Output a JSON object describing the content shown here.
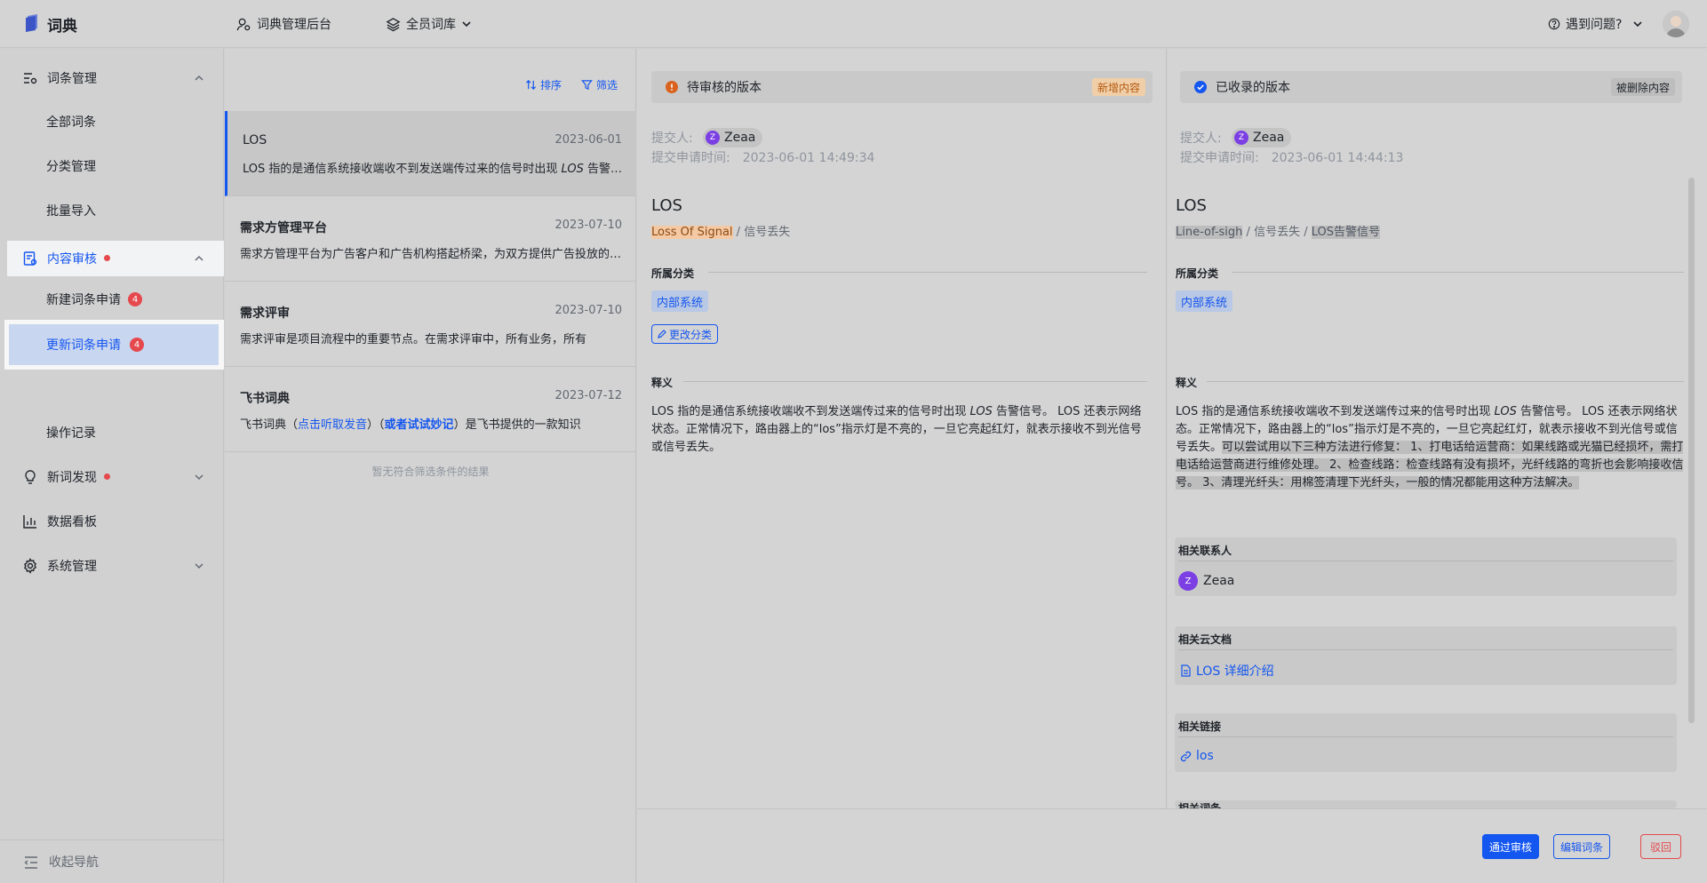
{
  "header": {
    "app_name": "词典",
    "admin_label": "词典管理后台",
    "library_label": "全员词库",
    "help_label": "遇到问题?"
  },
  "sidebar": {
    "groups": [
      {
        "label": "词条管理"
      },
      {
        "label": "内容审核"
      },
      {
        "label": "新词发现"
      },
      {
        "label": "数据看板"
      },
      {
        "label": "系统管理"
      }
    ],
    "subs": [
      {
        "label": "全部词条"
      },
      {
        "label": "分类管理"
      },
      {
        "label": "批量导入"
      },
      {
        "label": "新建词条申请",
        "badge": "4"
      },
      {
        "label": "更新词条申请",
        "badge": "4"
      },
      {
        "label": "操作记录"
      }
    ],
    "collapse_label": "收起导航"
  },
  "list": {
    "sort_label": "排序",
    "filter_label": "筛选",
    "items": [
      {
        "title": "LOS",
        "date": "2023-06-01",
        "desc_a": "LOS 指的是通信系统接收端收不到发送端传过来的信号时出现 ",
        "desc_b": "LOS",
        "desc_c": " 告警信号"
      },
      {
        "title": "需求方管理平台",
        "date": "2023-07-10",
        "desc": "需求方管理平台为广告客户和广告机构搭起桥梁，为双方提供广告投放的一站式服务"
      },
      {
        "title": "需求评审",
        "date": "2023-07-10",
        "desc": "需求评审是项目流程中的重要节点。在需求评审中，所有业务，所有"
      },
      {
        "title": "飞书词典",
        "date": "2023-07-12",
        "desc_a": "飞书词典（",
        "link_a": "点击听取发音",
        "desc_b": "）（",
        "link_b": "或者试试妙记",
        "desc_c": "）是飞书提供的一款知识"
      }
    ],
    "empty": "暂无符合筛选条件的结果"
  },
  "pending": {
    "title": "待审核的版本",
    "tag": "新增内容",
    "submitter_label": "提交人:",
    "submitter": "Zeaa",
    "submitter_initial": "Z",
    "time_label": "提交申请时间:",
    "time": "2023-06-01 14:49:34",
    "word": "LOS",
    "alias_a": "Loss Of Signal",
    "alias_sep": " / ",
    "alias_b": "信号丢失",
    "category_heading": "所属分类",
    "category": "内部系统",
    "edit_category": "更改分类",
    "definition_heading": "释义",
    "def_a": "LOS 指的是通信系统接收端收不到发送端传过来的信号时出现 ",
    "def_b": "LOS",
    "def_c": " 告警信号。 LOS 还表示网络状态。正常情况下，路由器上的“los”指示灯是不亮的，一旦它亮起红灯，就表示接收不到光信号或信号丢失。"
  },
  "accepted": {
    "title": "已收录的版本",
    "tag": "被删除内容",
    "submitter_label": "提交人:",
    "submitter": "Zeaa",
    "submitter_initial": "Z",
    "time_label": "提交申请时间:",
    "time": "2023-06-01 14:44:13",
    "word": "LOS",
    "alias_a": "Line-of-sigh",
    "alias_sep": " / ",
    "alias_b": "信号丢失",
    "alias_sep2": " / ",
    "alias_c": "LOS告警信号",
    "category_heading": "所属分类",
    "category": "内部系统",
    "definition_heading": "释义",
    "def_a": "LOS 指的是通信系统接收端收不到发送端传过来的信号时出现 ",
    "def_b": "LOS",
    "def_c": " 告警信号。 LOS 还表示网络状态。正常情况下，路由器上的“los”指示灯是不亮的，一旦它亮起红灯，就表示接收不到光信号或信号丢失。",
    "def_del": "可以尝试用以下三种方法进行修复： 1、打电话给运营商：如果线路或光猫已经损坏，需打电话给运营商进行维修处理。 2、检查线路：检查线路有没有损坏，光纤线路的弯折也会影响接收信号。 3、清理光纤头：用棉签清理下光纤头，一般的情况都能用这种方法解决。",
    "contacts_heading": "相关联系人",
    "contact": "Zeaa",
    "contact_initial": "Z",
    "docs_heading": "相关云文档",
    "doc": "LOS 详细介绍",
    "links_heading": "相关链接",
    "link": "los",
    "more_heading": "相关词条"
  },
  "actions": {
    "approve": "通过审核",
    "edit": "编辑词条",
    "reject": "驳回"
  }
}
